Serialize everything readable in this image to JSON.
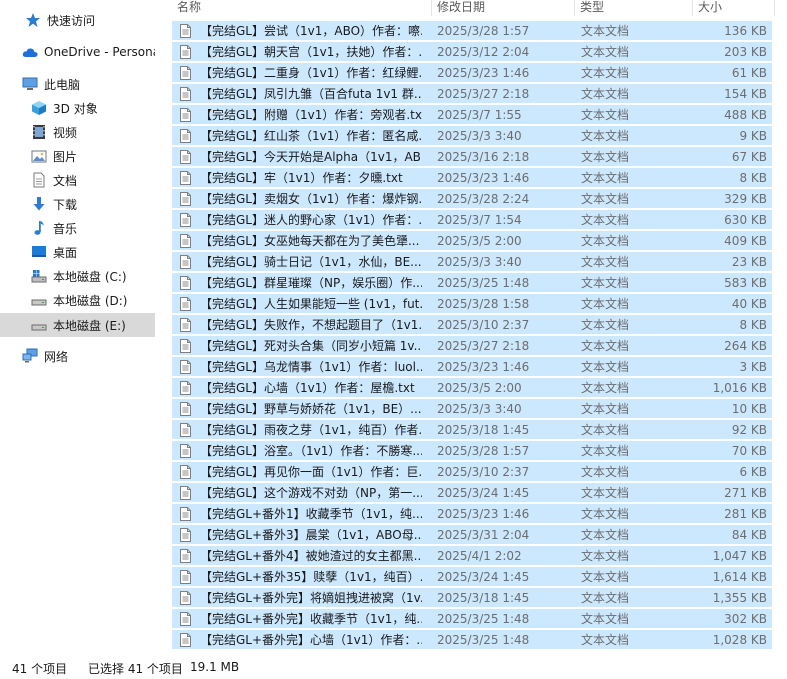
{
  "nav": {
    "items": [
      {
        "label": "快速访问",
        "icon": "star-icon"
      },
      {
        "label": "OneDrive - Persona",
        "icon": "cloud-icon"
      },
      {
        "label": "此电脑",
        "icon": "computer-icon"
      },
      {
        "label": "3D 对象",
        "icon": "cube-icon"
      },
      {
        "label": "视频",
        "icon": "video-icon"
      },
      {
        "label": "图片",
        "icon": "picture-icon"
      },
      {
        "label": "文档",
        "icon": "document-icon"
      },
      {
        "label": "下载",
        "icon": "download-icon"
      },
      {
        "label": "音乐",
        "icon": "music-icon"
      },
      {
        "label": "桌面",
        "icon": "desktop-icon"
      },
      {
        "label": "本地磁盘 (C:)",
        "icon": "drive-windows-icon"
      },
      {
        "label": "本地磁盘 (D:)",
        "icon": "drive-icon"
      },
      {
        "label": "本地磁盘 (E:)",
        "icon": "drive-icon"
      },
      {
        "label": "网络",
        "icon": "network-icon"
      }
    ]
  },
  "list": {
    "headers": {
      "name": "名称",
      "date": "修改日期",
      "type": "类型",
      "size": "大小"
    },
    "rows": [
      {
        "name": "【完结GL】尝试（1v1，ABO）作者：嚓...",
        "date": "2025/3/28 1:57",
        "type": "文本文档",
        "size": "136 KB"
      },
      {
        "name": "【完结GL】朝天宫（1v1，扶她）作者：...",
        "date": "2025/3/12 2:04",
        "type": "文本文档",
        "size": "203 KB"
      },
      {
        "name": "【完结GL】二重身（1v1）作者：红绿鲤...",
        "date": "2025/3/23 1:46",
        "type": "文本文档",
        "size": "61 KB"
      },
      {
        "name": "【完结GL】凤引九雏（百合futa 1v1 群...",
        "date": "2025/3/27 2:18",
        "type": "文本文档",
        "size": "154 KB"
      },
      {
        "name": "【完结GL】附赠（1v1）作者：旁观者.txt",
        "date": "2025/3/7 1:55",
        "type": "文本文档",
        "size": "488 KB"
      },
      {
        "name": "【完结GL】红山茶（1v1）作者：匿名咸...",
        "date": "2025/3/3 3:40",
        "type": "文本文档",
        "size": "9 KB"
      },
      {
        "name": "【完结GL】今天开始是Alpha（1v1，AB...",
        "date": "2025/3/16 2:18",
        "type": "文本文档",
        "size": "67 KB"
      },
      {
        "name": "【完结GL】牢（1v1）作者：夕曛.txt",
        "date": "2025/3/23 1:46",
        "type": "文本文档",
        "size": "8 KB"
      },
      {
        "name": "【完结GL】卖烟女（1v1）作者：爆炸钢...",
        "date": "2025/3/28 2:24",
        "type": "文本文档",
        "size": "329 KB"
      },
      {
        "name": "【完结GL】迷人的野心家（1v1）作者：...",
        "date": "2025/3/7 1:54",
        "type": "文本文档",
        "size": "630 KB"
      },
      {
        "name": "【完结GL】女巫她每天都在为了美色犟...",
        "date": "2025/3/5 2:00",
        "type": "文本文档",
        "size": "409 KB"
      },
      {
        "name": "【完结GL】骑士日记（1v1，水仙，BE...",
        "date": "2025/3/3 3:40",
        "type": "文本文档",
        "size": "23 KB"
      },
      {
        "name": "【完结GL】群星璀璨（NP，娱乐圈）作...",
        "date": "2025/3/25 1:48",
        "type": "文本文档",
        "size": "583 KB"
      },
      {
        "name": "【完结GL】人生如果能短一些 (1v1，fut...",
        "date": "2025/3/28 1:58",
        "type": "文本文档",
        "size": "40 KB"
      },
      {
        "name": "【完结GL】失败作，不想起题目了（1v1...",
        "date": "2025/3/10 2:37",
        "type": "文本文档",
        "size": "8 KB"
      },
      {
        "name": "【完结GL】死对头合集（同岁小短篇 1v...",
        "date": "2025/3/27 2:18",
        "type": "文本文档",
        "size": "264 KB"
      },
      {
        "name": "【完结GL】乌龙情事（1v1）作者：luol...",
        "date": "2025/3/23 1:46",
        "type": "文本文档",
        "size": "3 KB"
      },
      {
        "name": "【完结GL】心墙（1v1）作者：屋檐.txt",
        "date": "2025/3/5 2:00",
        "type": "文本文档",
        "size": "1,016 KB"
      },
      {
        "name": "【完结GL】野草与娇娇花（1v1，BE）...",
        "date": "2025/3/3 3:40",
        "type": "文本文档",
        "size": "10 KB"
      },
      {
        "name": "【完结GL】雨夜之芽（1v1，纯百）作者...",
        "date": "2025/3/18 1:45",
        "type": "文本文档",
        "size": "92 KB"
      },
      {
        "name": "【完结GL】浴室。（1v1）作者：不勝寒...",
        "date": "2025/3/28 1:57",
        "type": "文本文档",
        "size": "70 KB"
      },
      {
        "name": "【完结GL】再见你一面（1v1）作者：巨...",
        "date": "2025/3/10 2:37",
        "type": "文本文档",
        "size": "6 KB"
      },
      {
        "name": "【完结GL】这个游戏不对劲（NP，第一...",
        "date": "2025/3/24 1:45",
        "type": "文本文档",
        "size": "271 KB"
      },
      {
        "name": "【完结GL+番外1】收藏季节（1v1，纯...",
        "date": "2025/3/23 1:46",
        "type": "文本文档",
        "size": "281 KB"
      },
      {
        "name": "【完结GL+番外3】晨棠（1v1，ABO母...",
        "date": "2025/3/31 2:04",
        "type": "文本文档",
        "size": "84 KB"
      },
      {
        "name": "【完结GL+番外4】被她渣过的女主都黑...",
        "date": "2025/4/1 2:02",
        "type": "文本文档",
        "size": "1,047 KB"
      },
      {
        "name": "【完结GL+番外35】赎孽（1v1，纯百）...",
        "date": "2025/3/24 1:45",
        "type": "文本文档",
        "size": "1,614 KB"
      },
      {
        "name": "【完结GL+番外完】将嫡姐拽进被窝（1v...",
        "date": "2025/3/18 1:45",
        "type": "文本文档",
        "size": "1,355 KB"
      },
      {
        "name": "【完结GL+番外完】收藏季节（1v1，纯...",
        "date": "2025/3/25 1:48",
        "type": "文本文档",
        "size": "302 KB"
      },
      {
        "name": "【完结GL+番外完】心墙（1v1）作者：...",
        "date": "2025/3/25 1:48",
        "type": "文本文档",
        "size": "1,028 KB"
      }
    ]
  },
  "status": {
    "count": "41 个项目",
    "selected": "已选择 41 个项目",
    "size": "19.1 MB"
  },
  "colors": {
    "selection": "#cce8ff",
    "nav_selected": "#d9d9d9"
  }
}
